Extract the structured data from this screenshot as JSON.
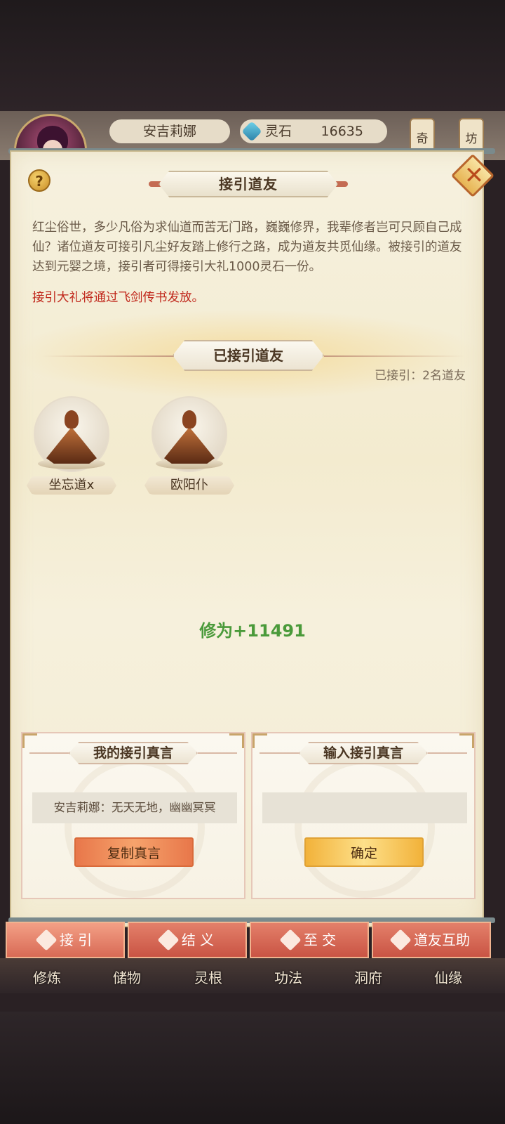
{
  "hud": {
    "player_name": "安吉莉娜",
    "resource_label": "灵石",
    "resource_value": "16635",
    "side_tabs": [
      "奇",
      "坊"
    ]
  },
  "dialog": {
    "title": "接引道友",
    "help_icon": "question-icon",
    "close_icon": "close-icon",
    "intro": "红尘俗世，多少凡俗为求仙道而苦无门路，巍巍修界，我辈修者岂可只顾自己成仙？诸位道友可接引凡尘好友踏上修行之路，成为道友共觅仙缘。被接引的道友达到元婴之境，接引者可得接引大礼1000灵石一份。",
    "notice": "接引大礼将通过飞剑传书发放。",
    "section_title": "已接引道友",
    "count_text": "已接引：2名道友",
    "friends": [
      {
        "name": "坐忘道x",
        "icon": "meditating-figure-icon"
      },
      {
        "name": "欧阳仆",
        "icon": "meditating-figure-icon"
      }
    ],
    "gain_text": "修为+11491",
    "my_code": {
      "title": "我的接引真言",
      "code_text": "安吉莉娜：无天无地，幽幽冥冥",
      "button": "复制真言"
    },
    "enter_code": {
      "title": "输入接引真言",
      "placeholder": "",
      "button": "确定"
    }
  },
  "tabs": [
    {
      "label": "接 引",
      "active": true
    },
    {
      "label": "结 义",
      "active": false
    },
    {
      "label": "至 交",
      "active": false
    },
    {
      "label": "道友互助",
      "active": false
    }
  ],
  "nav": [
    "修炼",
    "储物",
    "灵根",
    "功法",
    "洞府",
    "仙缘"
  ],
  "colors": {
    "parchment": "#f4eed8",
    "notice_red": "#c0281c",
    "gain_green": "#4a9a3a",
    "tab_red": "#d05a48"
  }
}
